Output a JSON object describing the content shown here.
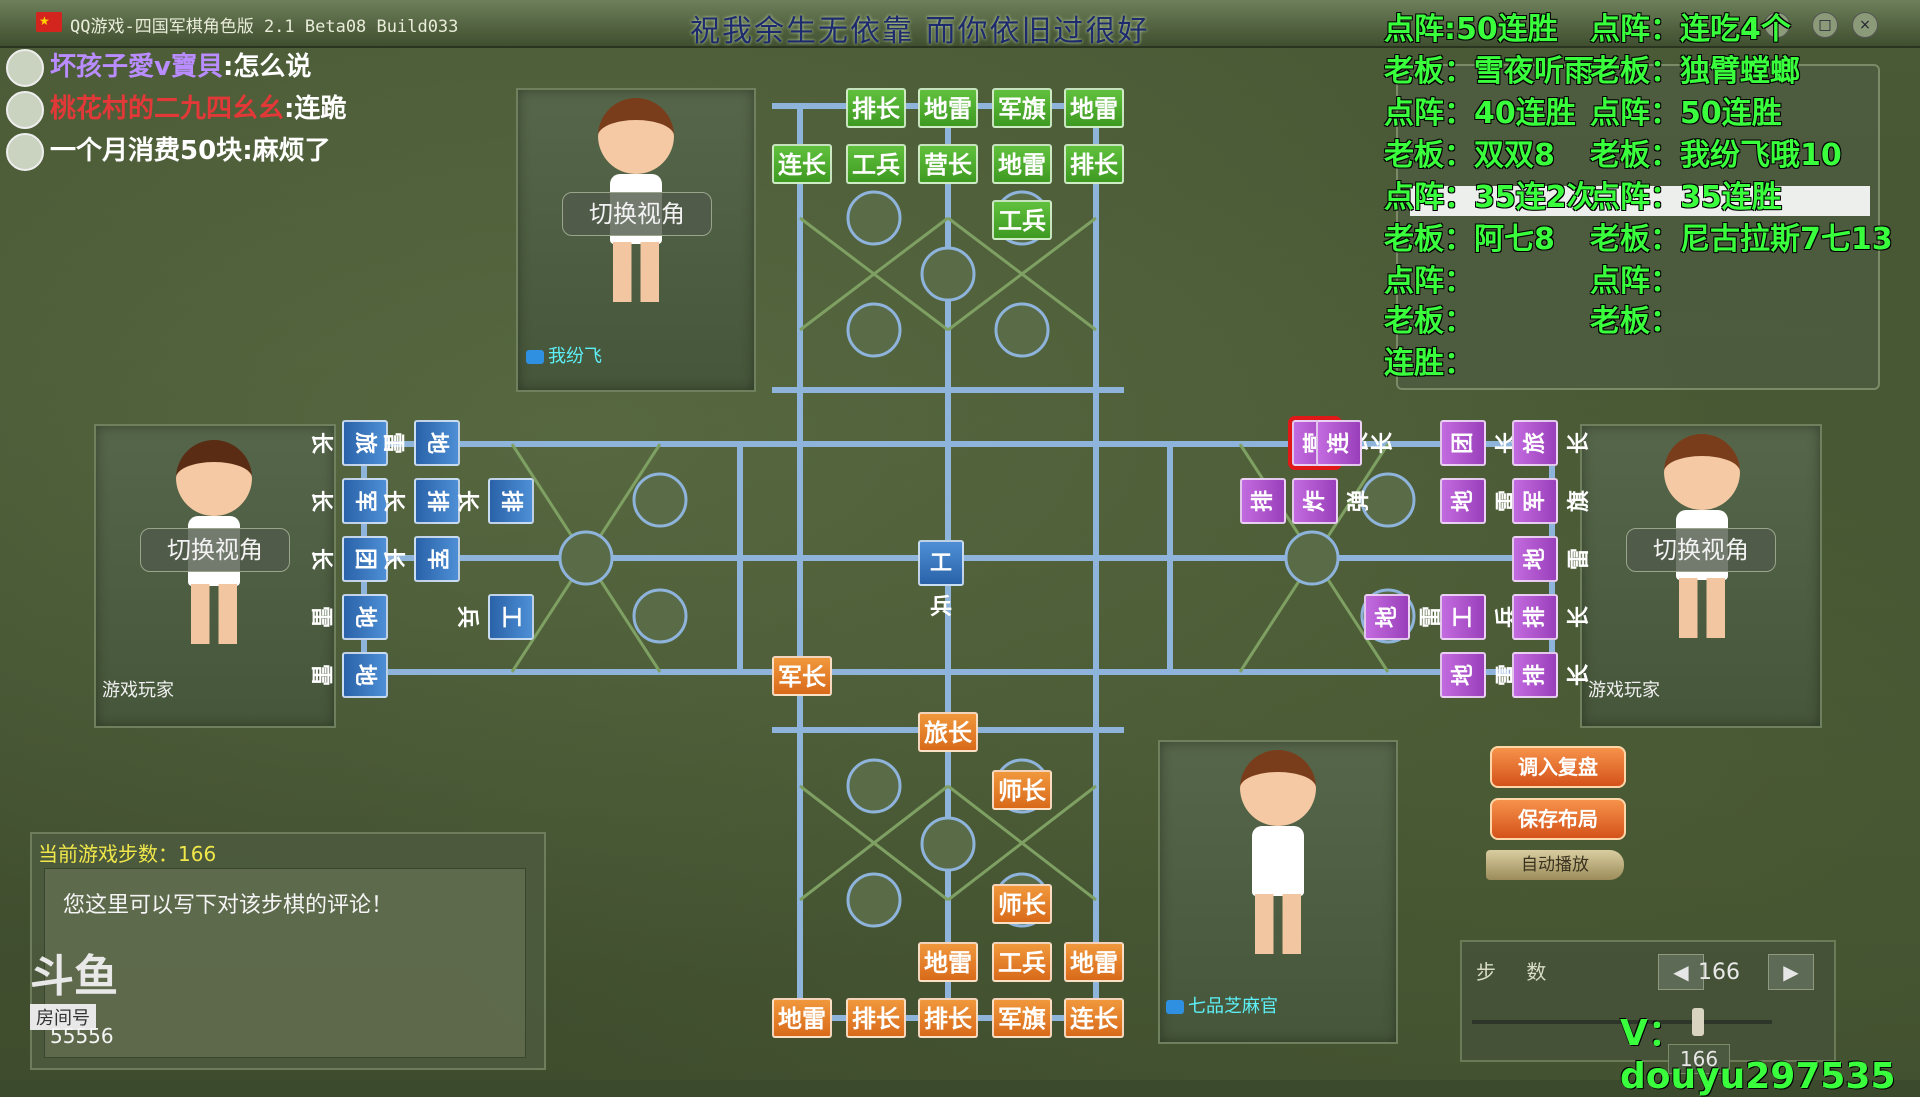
{
  "window": {
    "title": "QQ游戏-四国军棋角色版 2.1 Beta08 Build033",
    "banner": "祝我余生无依靠 而你依旧过很好",
    "controls": [
      "－",
      "□",
      "×"
    ]
  },
  "chat": [
    {
      "user": "坏孩子愛v寶貝",
      "sep": ":",
      "msg": "怎么说"
    },
    {
      "user": "桃花村的二九四幺幺",
      "sep": ":",
      "msg": "连跪"
    },
    {
      "user": "一个月消费50块",
      "sep": ":",
      "msg": "麻烦了"
    }
  ],
  "players": {
    "top": {
      "name": "我纷飞",
      "switch": "切换视角"
    },
    "left": {
      "name": "游戏玩家",
      "switch": "切换视角"
    },
    "right": {
      "name": "游戏玩家",
      "switch": "切换视角"
    },
    "bottom": {
      "name": "七品芝麻官"
    }
  },
  "pieces": {
    "top_row1": [
      "排长",
      "地雷",
      "军旗",
      "地雷"
    ],
    "top_row2": [
      "连长",
      "工兵",
      "营长",
      "地雷",
      "排长"
    ],
    "top_row3": [
      "工兵"
    ],
    "left_col1": [
      "旅长",
      "军长",
      "团长",
      "地雷",
      "地雷"
    ],
    "left_col2": [
      "地雷",
      "排长",
      "军长"
    ],
    "left_col3": [
      "排长",
      "工兵"
    ],
    "center": [
      "工兵"
    ],
    "bottom_junzhang": [
      "军长"
    ],
    "bottom_row1": [
      "旅长"
    ],
    "bottom_row2": [
      "师长"
    ],
    "bottom_row4": [
      "师长"
    ],
    "bottom_row5": [
      "地雷",
      "工兵",
      "地雷"
    ],
    "bottom_row6": [
      "地雷",
      "排长",
      "排长",
      "军旗",
      "连长"
    ],
    "right_col1": [
      "排长",
      "营长",
      "地雷"
    ],
    "right_col2": [
      "团长",
      "地雷",
      "工兵",
      "地雷"
    ],
    "right_col3": [
      "旅长",
      "军旗",
      "地雷",
      "排长",
      "连长"
    ],
    "right_misc": [
      "连长",
      "炸弹",
      "排长"
    ]
  },
  "overlay": {
    "lines": [
      "点阵:50连胜",
      "点阵：连吃4个",
      "老板：雪夜听雨",
      "老板：独臂螳螂",
      "点阵：40连胜",
      "点阵：50连胜",
      "老板：双双8",
      "老板：我纷飞哦10",
      "点阵：35连2次",
      "点阵：35连胜",
      "老板：阿七8",
      "老板：尼古拉斯7七13",
      "点阵：",
      "点阵：",
      "老板：",
      "老板：",
      "连胜："
    ]
  },
  "actions": {
    "load": "调入复盘",
    "save": "保存布局",
    "auto": "自动播放"
  },
  "steps": {
    "label": "步 数",
    "value": "166",
    "slider_value": "166",
    "slider_fraction": 0.72
  },
  "comment": {
    "header": "当前游戏步数：166",
    "placeholder": "您这里可以写下对该步棋的评论！"
  },
  "douyu": {
    "logo": "斗鱼",
    "room_label": "房间号",
    "room": "55556"
  },
  "contact": "V：douyu297535",
  "colors": {
    "green_text": "#39ff3d",
    "board_line": "#8eb4dc",
    "selected": "#e01818"
  }
}
